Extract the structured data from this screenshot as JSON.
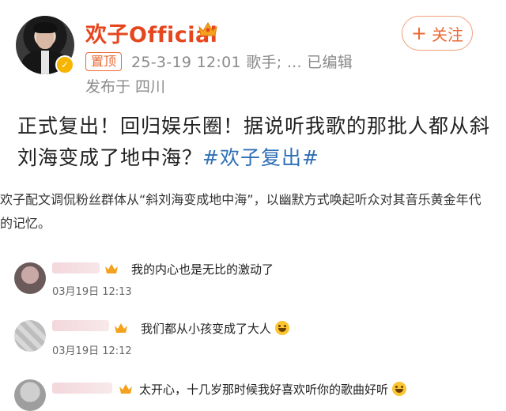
{
  "post": {
    "username": "欢子Official",
    "follow_label": "关注",
    "pin_label": "置顶",
    "meta": "25-3-19 12:01  歌手; ...  已编辑",
    "location": "发布于 四川",
    "text": "正式复出！回归娱乐圈！据说听我歌的那批人都从斜刘海变成了地中海？",
    "hashtag": "#欢子复出#"
  },
  "caption": "欢子配文调侃粉丝群体从“斜刘海变成地中海”，以幽默方式唤起听众对其音乐黄金年代的记忆。",
  "comments": [
    {
      "text": "我的内心也是无比的激动了",
      "time": "03月19日  12:13"
    },
    {
      "text": "我们都从小孩变成了大人",
      "time": "03月19日  12:12"
    },
    {
      "text": "太开心，十几岁那时候我好喜欢听你的歌曲好听",
      "time": ""
    }
  ],
  "colors": {
    "accent": "#e96a35",
    "username": "#e6461d",
    "hashtag": "#2f6fb6"
  },
  "icons": [
    "verified-badge-icon",
    "crown-icon",
    "plus-icon",
    "laugh-emoji-icon",
    "smile-emoji-icon"
  ]
}
